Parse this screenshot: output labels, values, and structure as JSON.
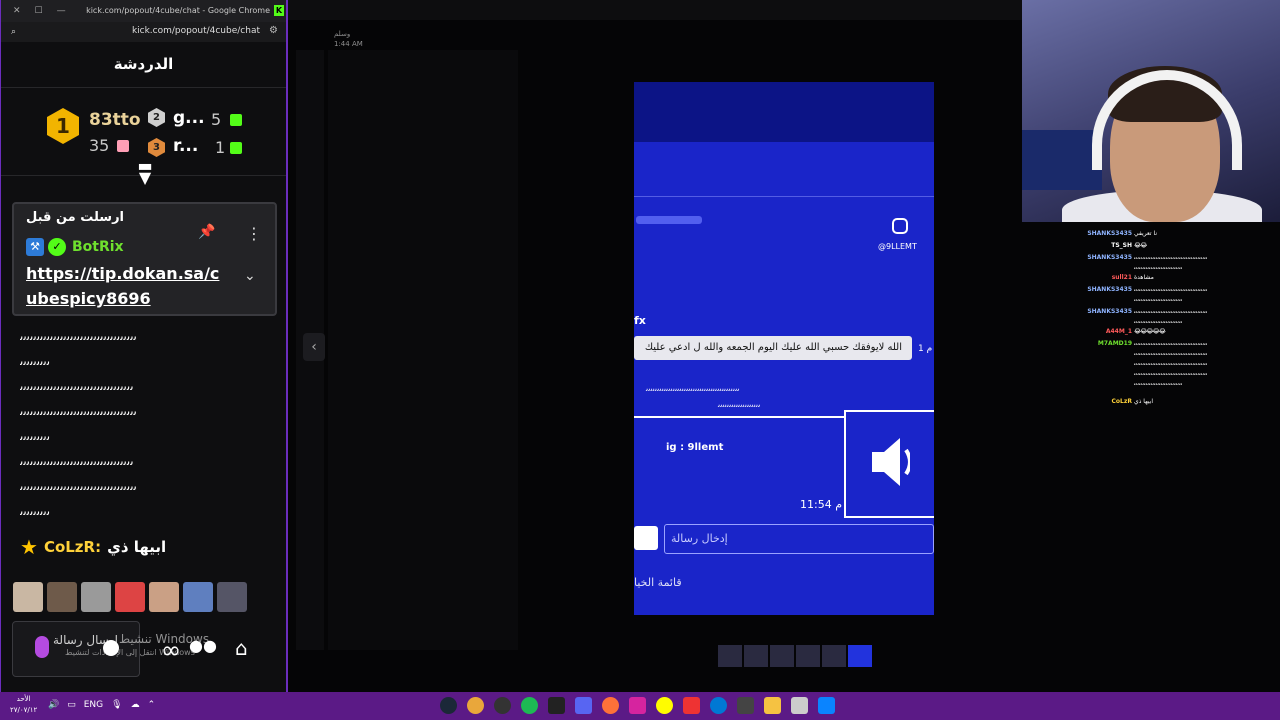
{
  "chrome_window": {
    "title": "kick.com/popout/4cube/chat - Google Chrome",
    "url": "kick.com/popout/4cube/chat"
  },
  "chat": {
    "header_title": "الدردشة",
    "leaderboard": {
      "first": {
        "rank": "1",
        "name": "83tto",
        "count": "35"
      },
      "second": {
        "rank": "2",
        "name": "g...",
        "count": "5"
      },
      "third": {
        "rank": "3",
        "name": "r...",
        "count": "1"
      }
    },
    "pinned": {
      "title": "ارسلت من قبل",
      "bot_name": "BotRix",
      "link": "https://tip.dokan.sa/cubespicy8696"
    },
    "messages": [
      "ﯨﯨﯨﯨﯨﯨﯨﯨﯨﯨﯨﯨﯨﯨﯨﯨﯨﯨﯨﯨﯨﯨﯨﯨﯨﯨﯨﯨﯨﯨﯨﯨﯨﯨﯨ",
      "ﯨﯨﯨﯨﯨﯨﯨﯨﯨ",
      "ﯨﯨﯨﯨﯨﯨﯨﯨﯨﯨﯨﯨﯨﯨﯨﯨﯨﯨﯨﯨﯨﯨﯨﯨﯨﯨﯨﯨﯨﯨﯨﯨﯨﯨ",
      "ﯨﯨﯨﯨﯨﯨﯨﯨﯨﯨﯨﯨﯨﯨﯨﯨﯨﯨﯨﯨﯨﯨﯨﯨﯨﯨﯨﯨﯨﯨﯨﯨﯨﯨﯨ",
      "ﯨﯨﯨﯨﯨﯨﯨﯨﯨ",
      "ﯨﯨﯨﯨﯨﯨﯨﯨﯨﯨﯨﯨﯨﯨﯨﯨﯨﯨﯨﯨﯨﯨﯨﯨﯨﯨﯨﯨﯨﯨﯨﯨﯨﯨ",
      "ﯨﯨﯨﯨﯨﯨﯨﯨﯨﯨﯨﯨﯨﯨﯨﯨﯨﯨﯨﯨﯨﯨﯨﯨﯨﯨﯨﯨﯨﯨﯨﯨﯨﯨﯨ",
      "ﯨﯨﯨﯨﯨﯨﯨﯨﯨ"
    ],
    "last_message": {
      "user": "CoLzR:",
      "text": "ابيها ذي"
    },
    "input_placeholder": "ارسال رسالة",
    "watermark_line1": "تنشيط Windows",
    "watermark_line2": "انتقل إلى الإعدادات لتنشيط Windows"
  },
  "background_app": {
    "name": "وسلم",
    "time": "1:44 AM"
  },
  "phone": {
    "insta_handle": "@9LLEMT",
    "fx": "fx",
    "bubble_text": "الله لايوفقك حسبي الله عليك اليوم الجمعه والله ل ادعي عليك",
    "bubble_time": "1 م",
    "scribble1": "ﯨﯨﯨﯨﯨﯨﯨﯨﯨﯨﯨﯨﯨﯨﯨﯨﯨﯨﯨﯨﯨﯨﯨﯨﯨﯨﯨﯨﯨﯨﯨﯨﯨﯨﯨﯨﯨﯨﯨﯨﯨﯨ",
    "scribble2": "ﯨﯨﯨﯨﯨﯨﯨﯨﯨﯨﯨﯨﯨﯨﯨﯨﯨﯨﯨ",
    "ig_text": "ig : 9llemt",
    "time": "11:54 م",
    "input_placeholder": "إدخال رسالة",
    "bottom_text": "قائمة الخيا"
  },
  "overlay_chat": [
    {
      "name": "SHANKS3435",
      "color": "#8fb4ff",
      "msg": "نا تعريفي"
    },
    {
      "name": "TS_SH",
      "color": "#ffffff",
      "msg": "😂😂"
    },
    {
      "name": "SHANKS3435",
      "color": "#8fb4ff",
      "msg": "ﯨﯨﯨﯨﯨﯨﯨﯨﯨﯨﯨﯨﯨﯨﯨﯨﯨﯨﯨﯨﯨﯨﯨﯨﯨﯨﯨﯨﯨﯨﯨﯨﯨﯨﯨﯨﯨﯨﯨﯨﯨﯨﯨﯨ"
    },
    {
      "name": "",
      "color": "#8fb4ff",
      "msg": "ﯨﯨﯨﯨﯨﯨﯨﯨﯨﯨﯨﯨﯨﯨﯨﯨﯨﯨﯨﯨﯨﯨﯨﯨﯨﯨﯨﯨﯨ"
    },
    {
      "name": "sull21",
      "color": "#ff5a5a",
      "msg": "مشاهدة"
    },
    {
      "name": "SHANKS3435",
      "color": "#8fb4ff",
      "msg": "ﯨﯨﯨﯨﯨﯨﯨﯨﯨﯨﯨﯨﯨﯨﯨﯨﯨﯨﯨﯨﯨﯨﯨﯨﯨﯨﯨﯨﯨﯨﯨﯨﯨﯨﯨﯨﯨﯨﯨﯨﯨﯨﯨﯨ"
    },
    {
      "name": "",
      "color": "#8fb4ff",
      "msg": "ﯨﯨﯨﯨﯨﯨﯨﯨﯨﯨﯨﯨﯨﯨﯨﯨﯨﯨﯨﯨﯨﯨﯨﯨﯨﯨﯨﯨﯨ"
    },
    {
      "name": "SHANKS3435",
      "color": "#8fb4ff",
      "msg": "ﯨﯨﯨﯨﯨﯨﯨﯨﯨﯨﯨﯨﯨﯨﯨﯨﯨﯨﯨﯨﯨﯨﯨﯨﯨﯨﯨﯨﯨﯨﯨﯨﯨﯨﯨﯨﯨﯨﯨﯨﯨﯨﯨﯨ"
    },
    {
      "name": "",
      "color": "#8fb4ff",
      "msg": "ﯨﯨﯨﯨﯨﯨﯨﯨﯨﯨﯨﯨﯨﯨﯨﯨﯨﯨﯨﯨﯨﯨﯨﯨﯨﯨﯨﯨﯨ"
    },
    {
      "name": "A44M_1",
      "color": "#ff5a5a",
      "msg": "😂😂😂😂😂"
    },
    {
      "name": "M7AMD19",
      "color": "#6fe02e",
      "msg": "ﯨﯨﯨﯨﯨﯨﯨﯨﯨﯨﯨﯨﯨﯨﯨﯨﯨﯨﯨﯨﯨﯨﯨﯨﯨﯨﯨﯨﯨﯨﯨﯨﯨﯨﯨﯨﯨﯨﯨﯨﯨﯨﯨﯨ"
    },
    {
      "name": "",
      "color": "#6fe02e",
      "msg": "ﯨﯨﯨﯨﯨﯨﯨﯨﯨﯨﯨﯨﯨﯨﯨﯨﯨﯨﯨﯨﯨﯨﯨﯨﯨﯨﯨﯨﯨﯨﯨﯨﯨﯨﯨﯨﯨﯨﯨﯨﯨﯨﯨﯨ"
    },
    {
      "name": "",
      "color": "#6fe02e",
      "msg": "ﯨﯨﯨﯨﯨﯨﯨﯨﯨﯨﯨﯨﯨﯨﯨﯨﯨﯨﯨﯨﯨﯨﯨﯨﯨﯨﯨﯨﯨﯨﯨﯨﯨﯨﯨﯨﯨﯨﯨﯨﯨﯨﯨﯨ"
    },
    {
      "name": "",
      "color": "#6fe02e",
      "msg": "ﯨﯨﯨﯨﯨﯨﯨﯨﯨﯨﯨﯨﯨﯨﯨﯨﯨﯨﯨﯨﯨﯨﯨﯨﯨﯨﯨﯨﯨﯨﯨﯨﯨﯨﯨﯨﯨﯨﯨﯨﯨﯨﯨﯨ"
    },
    {
      "name": "",
      "color": "#6fe02e",
      "msg": "ﯨﯨﯨﯨﯨﯨﯨﯨﯨﯨﯨﯨﯨﯨﯨﯨﯨﯨﯨﯨﯨﯨﯨﯨﯨﯨﯨﯨﯨ"
    },
    {
      "name": "CoLzR",
      "color": "#ffd23a",
      "msg": "ابيها ذي"
    }
  ],
  "taskbar": {
    "date_line1": "الأحد",
    "date_line2": "٢٧/٠٧/١٢",
    "lang": "ENG"
  },
  "colors": {
    "kick_green": "#53fc18",
    "taskbar_purple": "#5b1a86",
    "phone_blue": "#1a25c9",
    "gold": "#f2b400"
  }
}
